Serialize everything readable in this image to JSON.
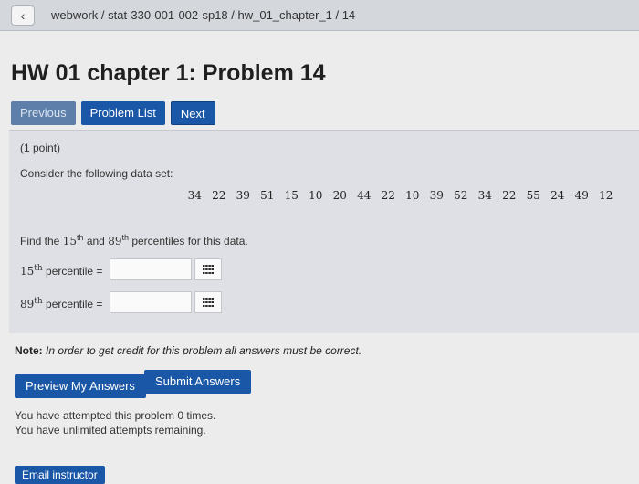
{
  "browser": {
    "back_glyph": "‹",
    "breadcrumb": "webwork / stat-330-001-002-sp18 / hw_01_chapter_1 / 14"
  },
  "page": {
    "title": "HW 01 chapter 1: Problem 14"
  },
  "nav": {
    "previous": "Previous",
    "problem_list": "Problem List",
    "next": "Next"
  },
  "problem": {
    "points": "(1 point)",
    "intro": "Consider the following data set:",
    "data": [
      "34",
      "22",
      "39",
      "51",
      "15",
      "10",
      "20",
      "44",
      "22",
      "10",
      "39",
      "52",
      "34",
      "22",
      "55",
      "24",
      "49",
      "12"
    ],
    "question": {
      "part1": "Find the ",
      "p1_num": "15",
      "p1_sup": "th",
      "part2": " and ",
      "p2_num": "89",
      "p2_sup": "th",
      "part3": " percentiles for this data."
    },
    "answers": [
      {
        "num": "15",
        "sup": "th",
        "label": " percentile =",
        "value": ""
      },
      {
        "num": "89",
        "sup": "th",
        "label": " percentile =",
        "value": ""
      }
    ]
  },
  "note": {
    "bold": "Note:",
    "text": " In order to get credit for this problem all answers must be correct."
  },
  "actions": {
    "preview": "Preview My Answers",
    "submit": "Submit Answers",
    "email": "Email instructor"
  },
  "status": {
    "attempted": "You have attempted this problem 0 times.",
    "remaining": "You have unlimited attempts remaining."
  },
  "icons": {
    "back": "chevron-left-icon",
    "answer_palette": "grid-icon"
  },
  "colors": {
    "primary_button": "#1a57a6",
    "problem_panel": "#dfe0e5"
  }
}
